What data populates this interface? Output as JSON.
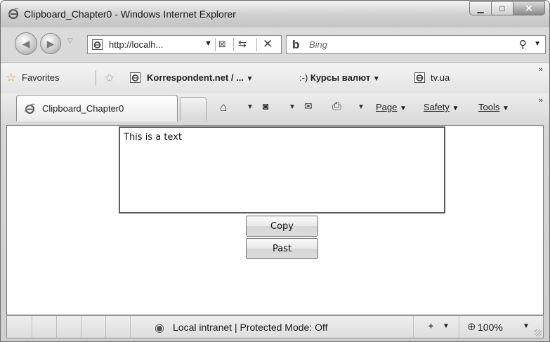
{
  "window": {
    "title": "Clipboard_Chapter0 - Windows Internet Explorer",
    "minimize_glyph": "▁",
    "maximize_glyph": "□",
    "close_glyph": "✕"
  },
  "navigation": {
    "address": "http://localh...",
    "search_placeholder": "Bing"
  },
  "favorites_bar": {
    "favorites_label": "Favorites",
    "items": [
      {
        "label": "Korrespondent.net / ...",
        "icon": "ie-page-icon"
      },
      {
        "label": "Курсы валют",
        "icon": "smiley-feed-icon"
      },
      {
        "label": "tv.ua",
        "icon": "ie-page-icon"
      }
    ]
  },
  "tabs": [
    {
      "label": "Clipboard_Chapter0",
      "active": true
    }
  ],
  "command_bar": {
    "page": "Page",
    "safety": "Safety",
    "tools": "Tools"
  },
  "page": {
    "textarea_value": "This is a text",
    "copy_button": "Copy",
    "paste_button": "Past"
  },
  "status_bar": {
    "zone_text": "Local intranet | Protected Mode: Off",
    "zoom": "100%"
  },
  "colors": {
    "chrome": "#d6d6d6",
    "content_bg": "#ffffff",
    "textarea_border": "#5a5a5a"
  }
}
